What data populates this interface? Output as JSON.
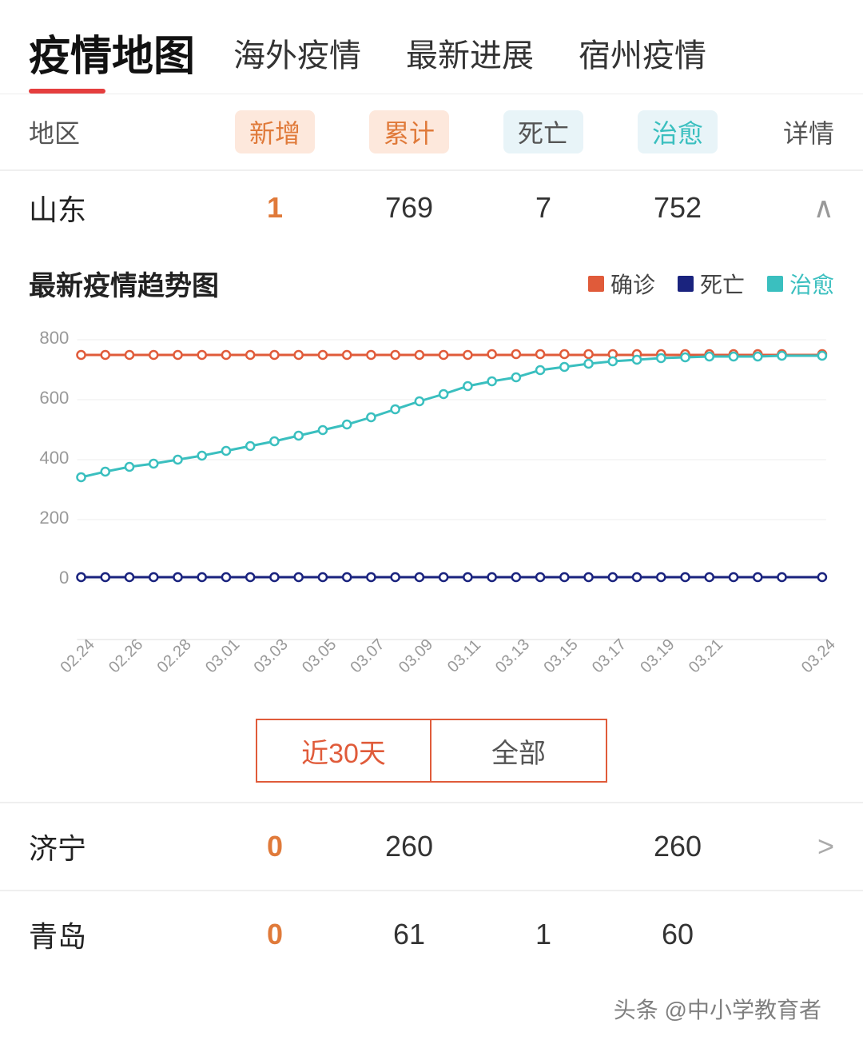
{
  "header": {
    "title": "疫情地图",
    "nav": [
      "海外疫情",
      "最新进展",
      "宿州疫情"
    ]
  },
  "table": {
    "columns": {
      "region": "地区",
      "new": "新增",
      "total": "累计",
      "death": "死亡",
      "recover": "治愈",
      "detail": "详情"
    },
    "main_row": {
      "region": "山东",
      "new": "1",
      "total": "769",
      "death": "7",
      "recover": "752",
      "detail": "∧"
    },
    "sub_rows": [
      {
        "region": "济宁",
        "new": "0",
        "total": "260",
        "death": "",
        "recover": "260",
        "detail": ">"
      },
      {
        "region": "青岛",
        "new": "0",
        "total": "61",
        "death": "1",
        "recover": "60",
        "detail": ""
      }
    ]
  },
  "chart": {
    "title": "最新疫情趋势图",
    "legend": {
      "confirm": "确诊",
      "death": "死亡",
      "recover": "治愈"
    },
    "x_labels": [
      "02.24",
      "02.26",
      "02.28",
      "03.01",
      "03.03",
      "03.05",
      "03.07",
      "03.09",
      "03.11",
      "03.13",
      "03.15",
      "03.17",
      "03.19",
      "03.21",
      "03.24"
    ],
    "y_labels": [
      "800",
      "600",
      "400",
      "200",
      "0"
    ],
    "confirm_data": [
      750,
      752,
      753,
      754,
      755,
      756,
      757,
      758,
      759,
      760,
      761,
      762,
      763,
      764,
      766,
      767,
      768,
      769,
      769,
      769,
      769,
      769,
      769,
      769,
      769,
      769,
      769,
      769,
      769,
      769,
      769
    ],
    "death_data": [
      7,
      7,
      7,
      7,
      7,
      7,
      7,
      7,
      7,
      7,
      7,
      7,
      7,
      7,
      7,
      7,
      7,
      7,
      7,
      7,
      7,
      7,
      7,
      7,
      7,
      7,
      7,
      7,
      7,
      7,
      7
    ],
    "recover_data": [
      340,
      360,
      375,
      385,
      400,
      415,
      430,
      445,
      460,
      480,
      500,
      520,
      540,
      560,
      590,
      620,
      645,
      665,
      680,
      700,
      715,
      725,
      732,
      738,
      742,
      745,
      748,
      750,
      751,
      752,
      752
    ]
  },
  "time_filter": {
    "btn_30": "近30天",
    "btn_all": "全部"
  },
  "watermark": "头条 @中小学教育者"
}
